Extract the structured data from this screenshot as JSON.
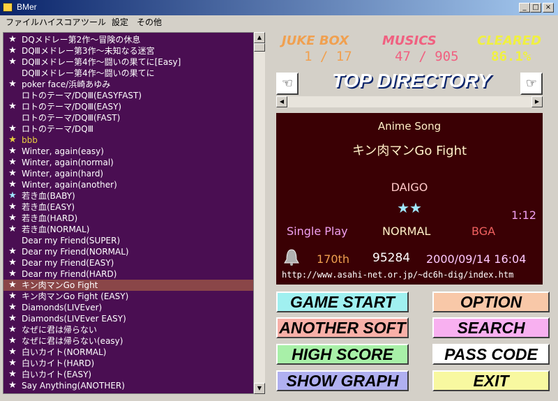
{
  "window": {
    "title": "BMer",
    "minimize": "_",
    "maximize": "□",
    "close": "×"
  },
  "menu": [
    "ファイル",
    "ハイスコア",
    "ツール",
    "設定",
    "その他"
  ],
  "songs": [
    {
      "star": "★",
      "star_color": "#ffffff",
      "title": "DQメドレー第2作～冒険の休息"
    },
    {
      "star": "★",
      "star_color": "#ffffff",
      "title": "DQⅢメドレー第3作～未知なる迷宮"
    },
    {
      "star": "★",
      "star_color": "#ffffff",
      "title": "DQⅢメドレー第4作～闘いの果てに[Easy]"
    },
    {
      "star": "",
      "star_color": "#ffffff",
      "title": "DQⅢメドレー第4作～闘いの果てに"
    },
    {
      "star": "★",
      "star_color": "#ffffff",
      "title": "poker face/浜崎あゆみ"
    },
    {
      "star": "",
      "star_color": "#ffffff",
      "title": "ロトのテーマ/DQⅢ(EASYFAST)"
    },
    {
      "star": "★",
      "star_color": "#ffffff",
      "title": "ロトのテーマ/DQⅢ(EASY)"
    },
    {
      "star": "",
      "star_color": "#ffffff",
      "title": "ロトのテーマ/DQⅢ(FAST)"
    },
    {
      "star": "★",
      "star_color": "#ffffff",
      "title": "ロトのテーマ/DQⅢ"
    },
    {
      "star": "★",
      "star_color": "#e8d040",
      "title": "bbb",
      "title_color": "#e8d040"
    },
    {
      "star": "★",
      "star_color": "#ffffff",
      "title": "Winter, again(easy)"
    },
    {
      "star": "★",
      "star_color": "#ffffff",
      "title": "Winter, again(normal)"
    },
    {
      "star": "★",
      "star_color": "#ffffff",
      "title": "Winter, again(hard)"
    },
    {
      "star": "★",
      "star_color": "#ffffff",
      "title": "Winter, again(another)"
    },
    {
      "star": "★",
      "star_color": "#a0e8ff",
      "title": "若き血(BABY)"
    },
    {
      "star": "★",
      "star_color": "#ffffff",
      "title": "若き血(EASY)"
    },
    {
      "star": "★",
      "star_color": "#ffffff",
      "title": "若き血(HARD)"
    },
    {
      "star": "★",
      "star_color": "#ffffff",
      "title": "若き血(NORMAL)"
    },
    {
      "star": "",
      "star_color": "#ffffff",
      "title": "Dear my Friend(SUPER)"
    },
    {
      "star": "★",
      "star_color": "#ffffff",
      "title": "Dear my Friend(NORMAL)"
    },
    {
      "star": "★",
      "star_color": "#ffffff",
      "title": "Dear my Friend(EASY)"
    },
    {
      "star": "★",
      "star_color": "#ffffff",
      "title": "Dear my Friend(HARD)"
    },
    {
      "star": "★",
      "star_color": "#ffffff",
      "title": "キン肉マンGo Fight",
      "selected": true
    },
    {
      "star": "★",
      "star_color": "#ffffff",
      "title": "キン肉マンGo Fight (EASY)"
    },
    {
      "star": "★",
      "star_color": "#ffffff",
      "title": "Diamonds(LIVEver)"
    },
    {
      "star": "★",
      "star_color": "#ffffff",
      "title": "Diamonds(LIVEver EASY)"
    },
    {
      "star": "★",
      "star_color": "#ffffff",
      "title": "なぜに君は帰らない"
    },
    {
      "star": "★",
      "star_color": "#ffffff",
      "title": "なぜに君は帰らない(easy)"
    },
    {
      "star": "★",
      "star_color": "#ffffff",
      "title": "白いカイト(NORMAL)"
    },
    {
      "star": "★",
      "star_color": "#ffffff",
      "title": "白いカイト(HARD)"
    },
    {
      "star": "★",
      "star_color": "#ffffff",
      "title": "白いカイト(EASY)"
    },
    {
      "star": "★",
      "star_color": "#ffffff",
      "title": "Say Anything(ANOTHER)"
    }
  ],
  "stats": {
    "jukebox_label": "JUKE BOX",
    "jukebox_value": "1 / 17",
    "musics_label": "MUSICS",
    "musics_value": "47 / 905",
    "cleared_label": "CLEARED",
    "cleared_value": "86.1%"
  },
  "directory": "TOP DIRECTORY",
  "info": {
    "genre": "Anime Song",
    "title": "キン肉マンGo Fight",
    "artist": "DAIGO",
    "stars": "★★",
    "length": "1:12",
    "play_mode": "Single Play",
    "difficulty": "NORMAL",
    "format": "BGA",
    "rank": "170th",
    "score": "95284",
    "date": "2000/09/14 16:04",
    "url": "http://www.asahi-net.or.jp/~dc6h-dig/index.htm"
  },
  "buttons": {
    "game_start": "GAME START",
    "option": "OPTION",
    "another_soft": "ANOTHER SOFT",
    "search": "SEARCH",
    "high_score": "HIGH SCORE",
    "pass_code": "PASS CODE",
    "show_graph": "SHOW GRAPH",
    "exit": "EXIT"
  },
  "colors": {
    "list_bg": "#4a0e52",
    "info_bg": "#3a0004",
    "jukebox": "#f0a050",
    "musics": "#f06080",
    "cleared": "#f0f040"
  }
}
